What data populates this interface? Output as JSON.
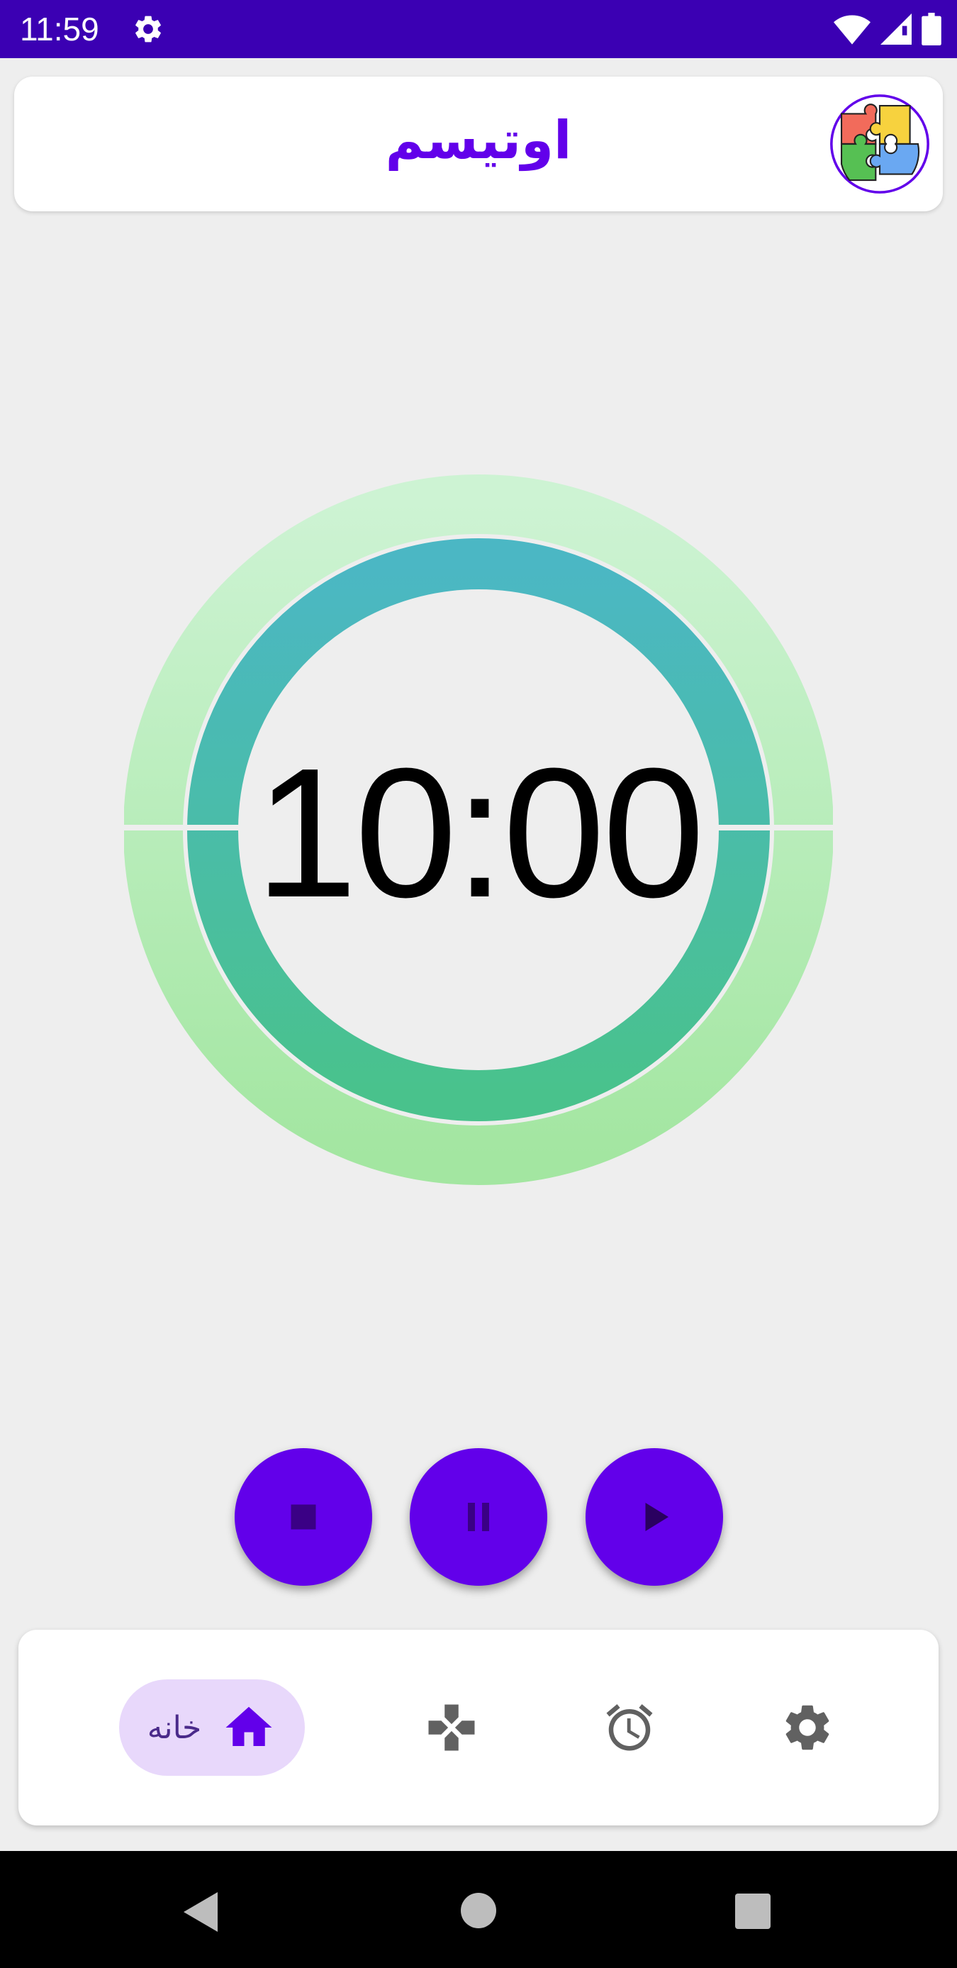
{
  "status_bar": {
    "time": "11:59",
    "bg_color": "#3b00b3"
  },
  "header": {
    "title": "اوتیسم",
    "title_color": "#6200ea",
    "logo_icon": "puzzle-logo-icon"
  },
  "timer": {
    "time_text": "10:00",
    "outer_ring_colors": [
      "#cdf3d3",
      "#a3e6a1"
    ],
    "inner_ring_colors": [
      "#4bb7c4",
      "#49c28c"
    ]
  },
  "controls": {
    "stop_icon": "stop-icon",
    "pause_icon": "pause-icon",
    "play_icon": "play-icon",
    "button_color": "#6200ea"
  },
  "bottom_nav": {
    "items": [
      {
        "label": "خانه",
        "icon": "home-icon",
        "active": true
      },
      {
        "label": "",
        "icon": "gamepad-icon",
        "active": false
      },
      {
        "label": "",
        "icon": "alarm-clock-icon",
        "active": false
      },
      {
        "label": "",
        "icon": "settings-gear-icon",
        "active": false
      }
    ]
  },
  "system_nav": {
    "back": "back-icon",
    "home": "home-circle-icon",
    "recents": "recents-icon"
  }
}
